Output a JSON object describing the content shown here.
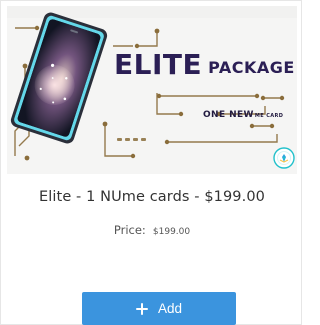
{
  "product": {
    "banner": {
      "title_big": "ELITE",
      "title_small": "PACKAGE",
      "subtitle_main": "ONE NEW",
      "subtitle_small": "ME CARD"
    },
    "name": "Elite - 1 NUme cards - $199.00",
    "price_label": "Price:",
    "price_value": "$199.00",
    "add_label": "Add",
    "add_icon": "plus-icon"
  },
  "colors": {
    "button": "#3b94de",
    "banner_text": "#2b1f55"
  }
}
